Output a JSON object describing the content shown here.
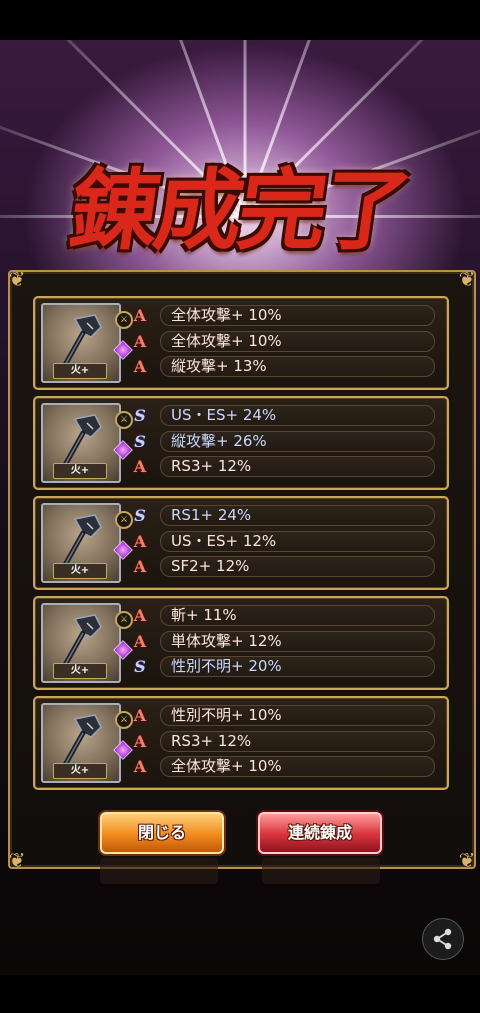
{
  "title": "錬成完了",
  "cards": [
    {
      "element": "火+",
      "rows": [
        {
          "rank": "A",
          "text": "全体攻撃+ 10%"
        },
        {
          "rank": "A",
          "text": "全体攻撃+ 10%"
        },
        {
          "rank": "A",
          "text": "縦攻撃+ 13%"
        }
      ]
    },
    {
      "element": "火+",
      "rows": [
        {
          "rank": "S",
          "text": "US・ES+ 24%"
        },
        {
          "rank": "S",
          "text": "縦攻撃+ 26%"
        },
        {
          "rank": "A",
          "text": "RS3+ 12%"
        }
      ]
    },
    {
      "element": "火+",
      "rows": [
        {
          "rank": "S",
          "text": "RS1+ 24%"
        },
        {
          "rank": "A",
          "text": "US・ES+ 12%"
        },
        {
          "rank": "A",
          "text": "SF2+ 12%"
        }
      ]
    },
    {
      "element": "火+",
      "rows": [
        {
          "rank": "A",
          "text": "斬+ 11%"
        },
        {
          "rank": "A",
          "text": "単体攻撃+ 12%"
        },
        {
          "rank": "S",
          "text": "性別不明+ 20%"
        }
      ]
    },
    {
      "element": "火+",
      "rows": [
        {
          "rank": "A",
          "text": "性別不明+ 10%"
        },
        {
          "rank": "A",
          "text": "RS3+ 12%"
        },
        {
          "rank": "A",
          "text": "全体攻撃+ 10%"
        }
      ]
    }
  ],
  "buttons": {
    "close": "閉じる",
    "continue": "連続錬成"
  },
  "icons": {
    "share": "share-icon",
    "weapon": "axe-weapon-icon",
    "corner": "ornament-corner-icon"
  },
  "colors": {
    "rank_a": "#f28070",
    "rank_s": "#c9d0f6",
    "frame_gold": "#c8a65a",
    "close_button": "#f08a1c",
    "continue_button": "#d8323c"
  }
}
